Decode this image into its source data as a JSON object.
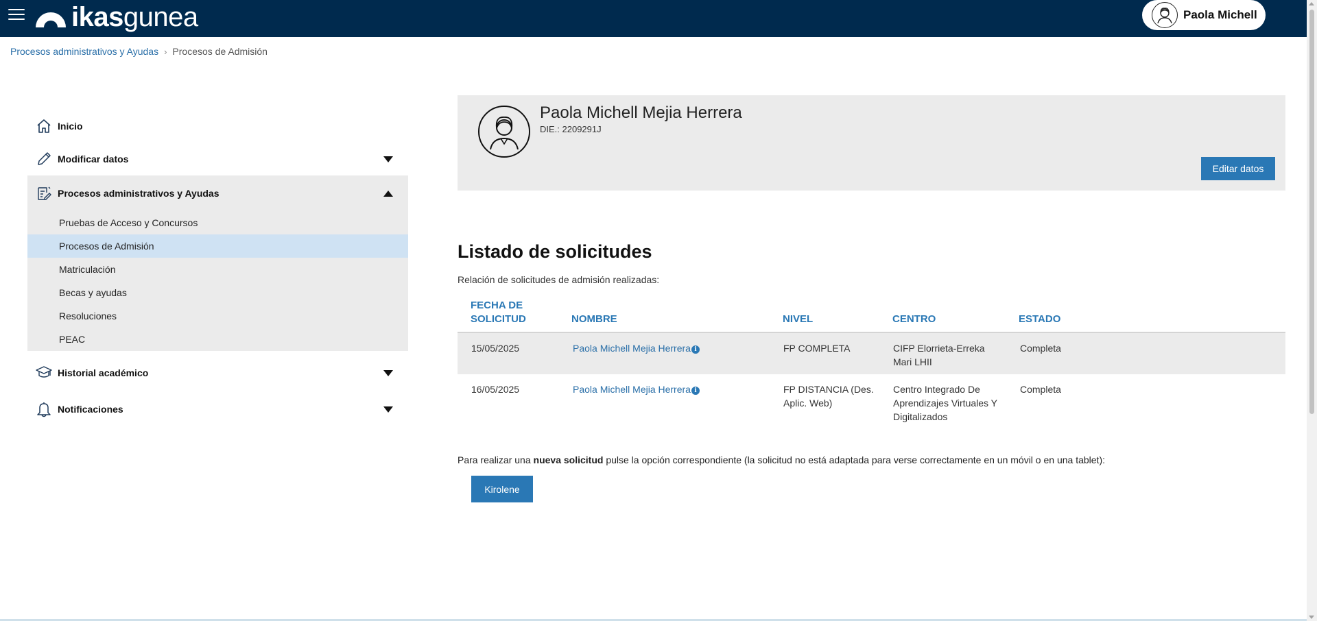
{
  "header": {
    "logo_bold": "ikas",
    "logo_light": "gunea",
    "user_name": "Paola Michell"
  },
  "breadcrumb": {
    "parent": "Procesos administrativos y Ayudas",
    "current": "Procesos de Admisión"
  },
  "sidebar": {
    "items": [
      {
        "label": "Inicio",
        "icon": "home-icon"
      },
      {
        "label": "Modificar datos",
        "icon": "pencil-icon"
      },
      {
        "label": "Procesos administrativos y Ayudas",
        "icon": "document-edit-icon"
      },
      {
        "label": "Historial académico",
        "icon": "graduation-cap-icon"
      },
      {
        "label": "Notificaciones",
        "icon": "bell-icon"
      }
    ],
    "subitems": [
      {
        "label": "Pruebas de Acceso y Concursos"
      },
      {
        "label": "Procesos de Admisión",
        "active": true
      },
      {
        "label": "Matriculación"
      },
      {
        "label": "Becas y ayudas"
      },
      {
        "label": "Resoluciones"
      },
      {
        "label": "PEAC"
      }
    ]
  },
  "profile": {
    "name": "Paola Michell Mejia Herrera",
    "die": "DIE.: 2209291J",
    "edit_button": "Editar datos"
  },
  "list": {
    "title": "Listado de solicitudes",
    "description": "Relación de solicitudes de admisión realizadas:",
    "headers": {
      "fecha_1": "FECHA DE",
      "fecha_2": "SOLICITUD",
      "nombre": "NOMBRE",
      "nivel": "NIVEL",
      "centro": "CENTRO",
      "estado": "ESTADO"
    },
    "rows": [
      {
        "fecha": "15/05/2025",
        "nombre": "Paola Michell Mejia Herrera",
        "nivel_1": "FP COMPLETA",
        "nivel_2": "",
        "centro_1": "CIFP Elorrieta-Erreka",
        "centro_2": "Mari LHII",
        "centro_3": "",
        "estado": "Completa"
      },
      {
        "fecha": "16/05/2025",
        "nombre": "Paola Michell Mejia Herrera",
        "nivel_1": "FP DISTANCIA (Des.",
        "nivel_2": "Aplic. Web)",
        "centro_1": "Centro Integrado De",
        "centro_2": "Aprendizajes Virtuales Y",
        "centro_3": "Digitalizados",
        "estado": "Completa"
      }
    ]
  },
  "new_request": {
    "text_before": "Para realizar una ",
    "text_bold": "nueva solicitud",
    "text_after": " pulse la opción correspondiente (la solicitud no está adaptada para verse correctamente en un móvil o en una tablet):",
    "button": "Kirolene"
  },
  "colors": {
    "topbar": "#002a4e",
    "accent": "#2a78b5",
    "panel": "#ebebeb",
    "active_sub": "#cfe2f3"
  }
}
